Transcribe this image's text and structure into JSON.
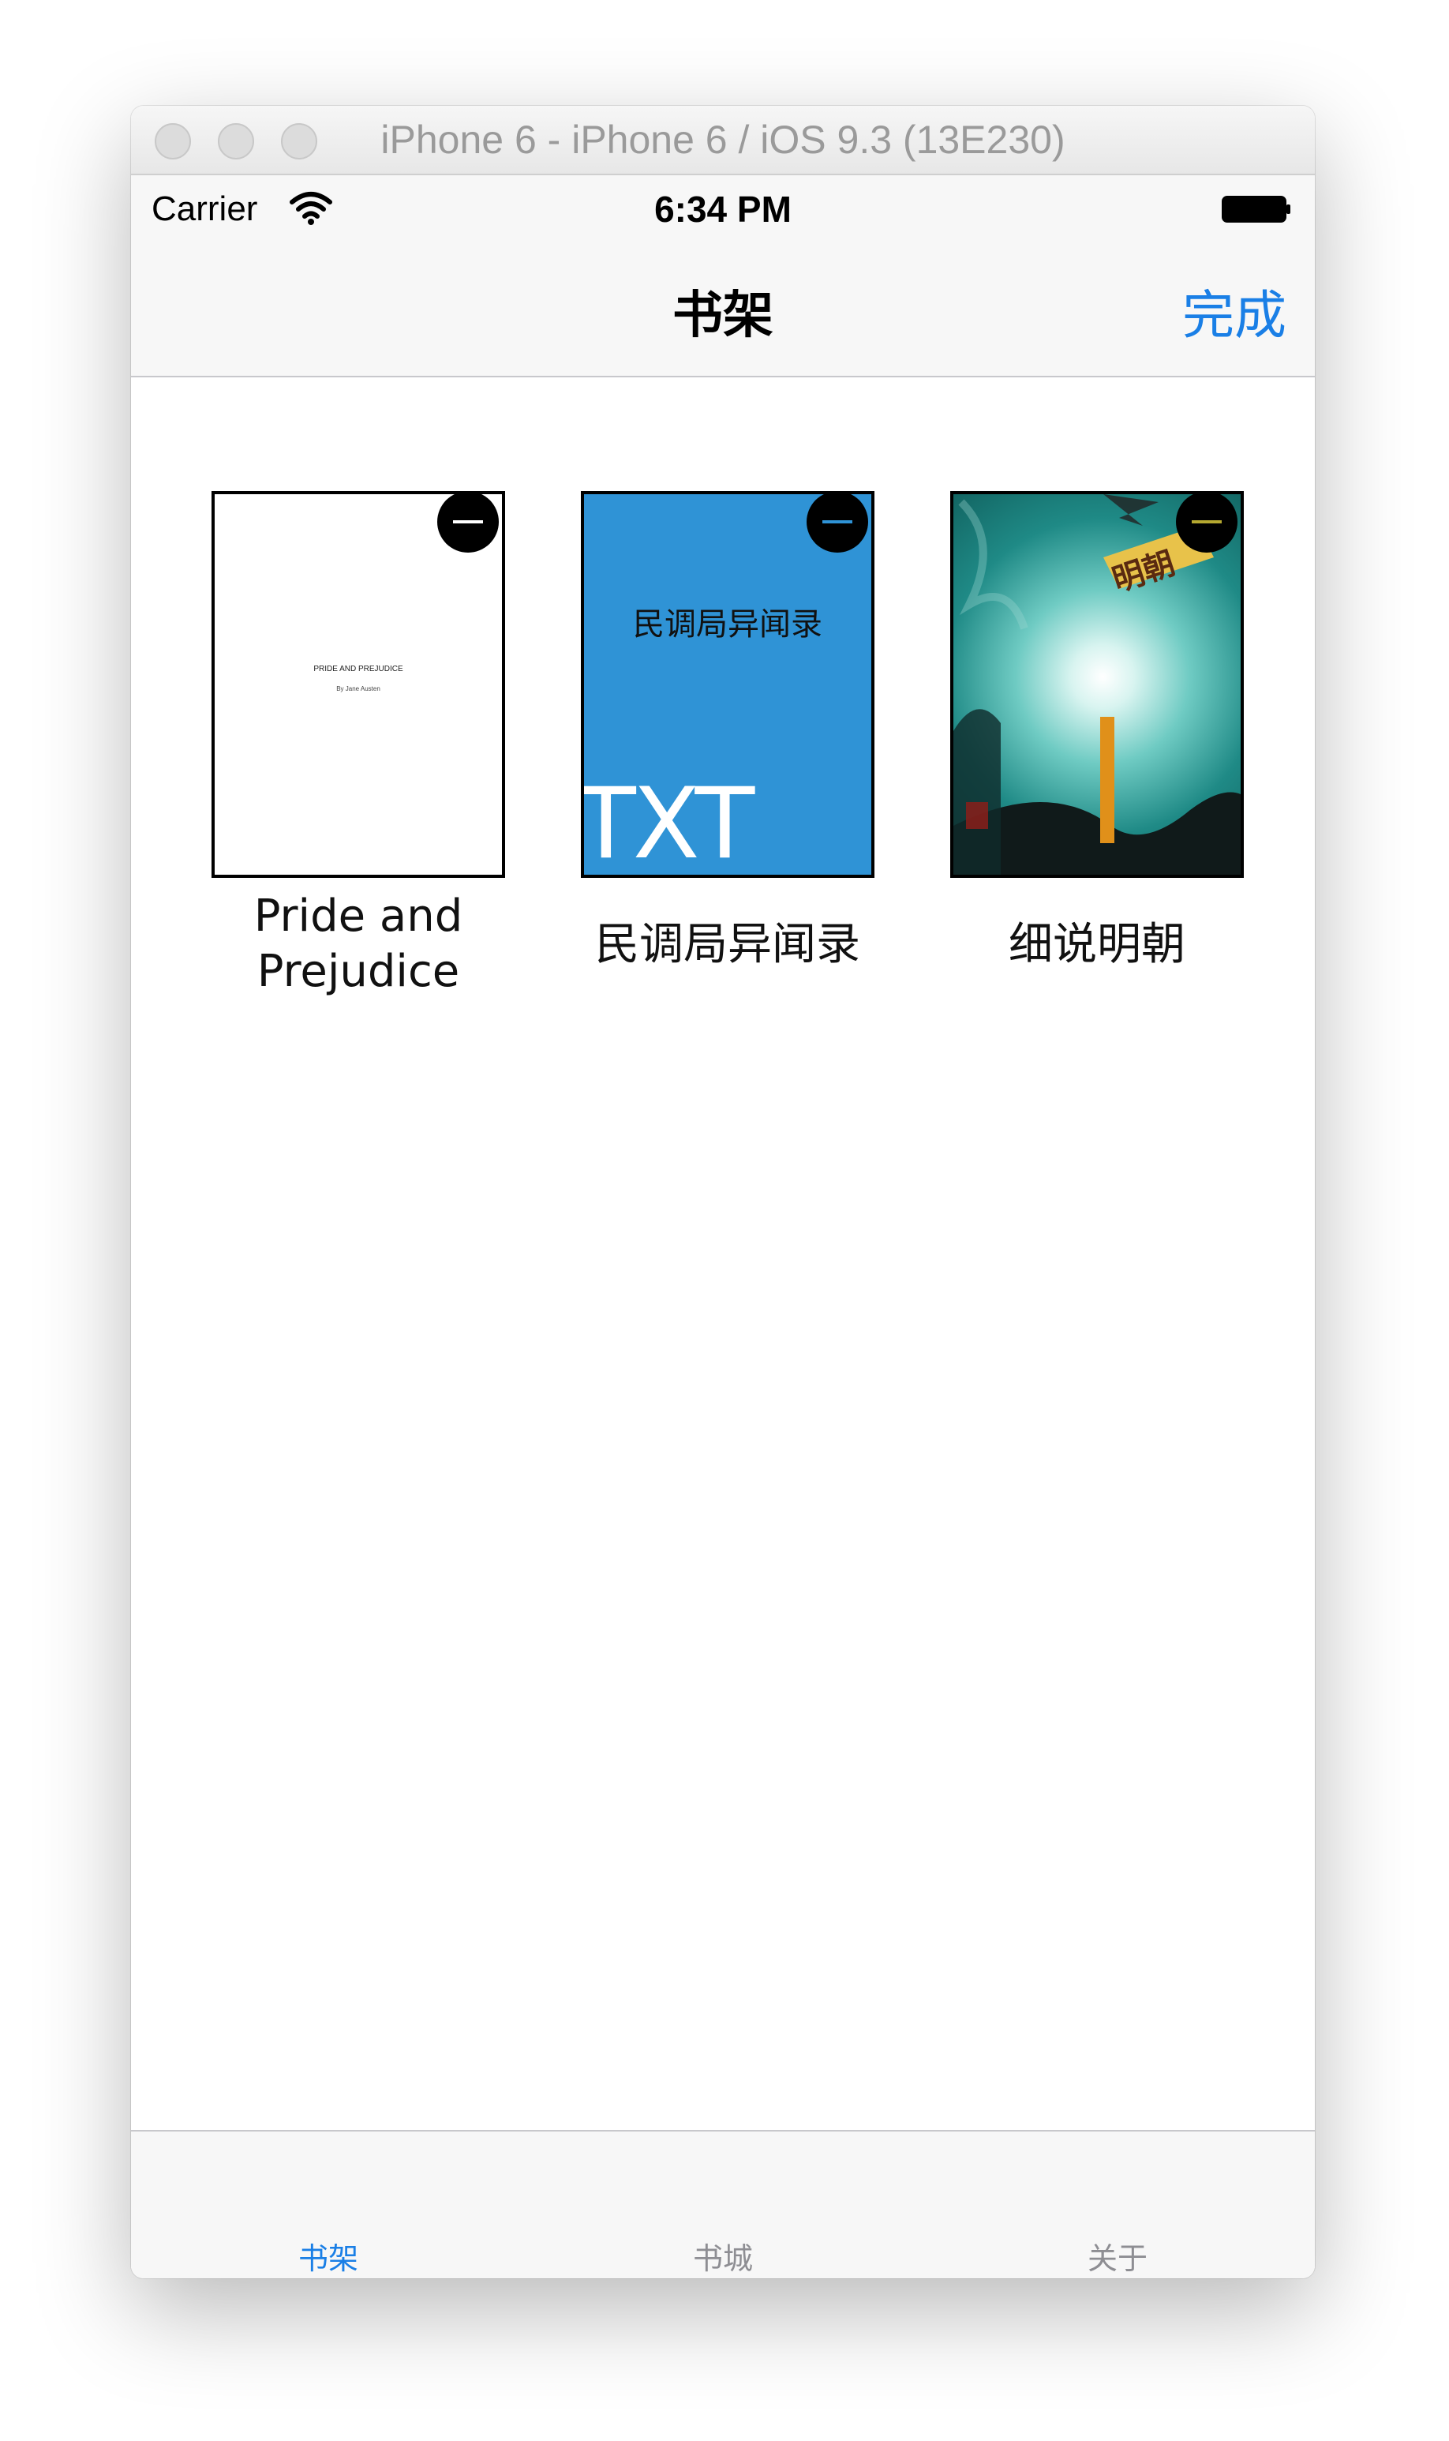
{
  "window": {
    "title": "iPhone 6 - iPhone 6 / iOS 9.3 (13E230)"
  },
  "status_bar": {
    "carrier": "Carrier",
    "time": "6:34 PM"
  },
  "nav": {
    "title": "书架",
    "done_label": "完成",
    "accent_color": "#1a7fe6"
  },
  "books": [
    {
      "label": "Pride and Prejudice",
      "cover_title": "PRIDE AND PREJUDICE",
      "cover_author": "By Jane Austen"
    },
    {
      "label": "民调局异闻录",
      "cover_title": "民调局异闻录",
      "cover_badge": "TXT",
      "cover_color": "#2f93d6"
    },
    {
      "label": "细说明朝",
      "cover_title": "明朝"
    }
  ],
  "tabs": [
    {
      "label": "书架",
      "active": true
    },
    {
      "label": "书城",
      "active": false
    },
    {
      "label": "关于",
      "active": false
    }
  ],
  "icons": {
    "delete": "minus-circle-icon",
    "wifi": "wifi-icon",
    "battery": "battery-icon"
  }
}
